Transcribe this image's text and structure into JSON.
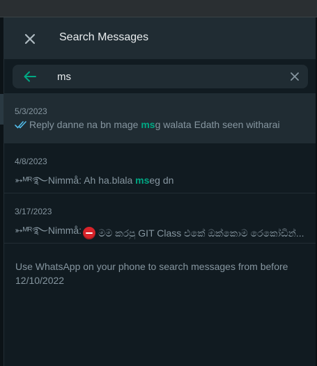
{
  "header": {
    "title": "Search Messages",
    "close_icon": "close-icon"
  },
  "search": {
    "value": "ms",
    "back_icon": "arrow-left-icon",
    "clear_icon": "clear-icon"
  },
  "results": [
    {
      "date": "5/3/2023",
      "status_icon": "double-check-icon",
      "before": "Reply danne na bn mage ",
      "match": "ms",
      "after": "g walata Edath seen witharai"
    },
    {
      "date": "4/8/2023",
      "prefix": "➳ᴹᴿ࿐Nimmå: ",
      "before": "Ah ha.blala ",
      "match": "ms",
      "after": "eg dn"
    },
    {
      "date": "3/17/2023",
      "prefix": "➳ᴹᴿ࿐Nimmå: ",
      "emoji_icon": "no-entry-icon",
      "text": "මම කරපු GIT Class එකේ ඔක්කොම රෙකෝඩින්..."
    }
  ],
  "footer_note": "Use WhatsApp on your phone to search messages from before 12/10/2022",
  "colors": {
    "accent": "#00a884",
    "panel_bg": "#111b21",
    "header_bg": "#202c33",
    "text_primary": "#e9edef",
    "text_secondary": "#8696a0",
    "read_ticks": "#53bdeb"
  }
}
